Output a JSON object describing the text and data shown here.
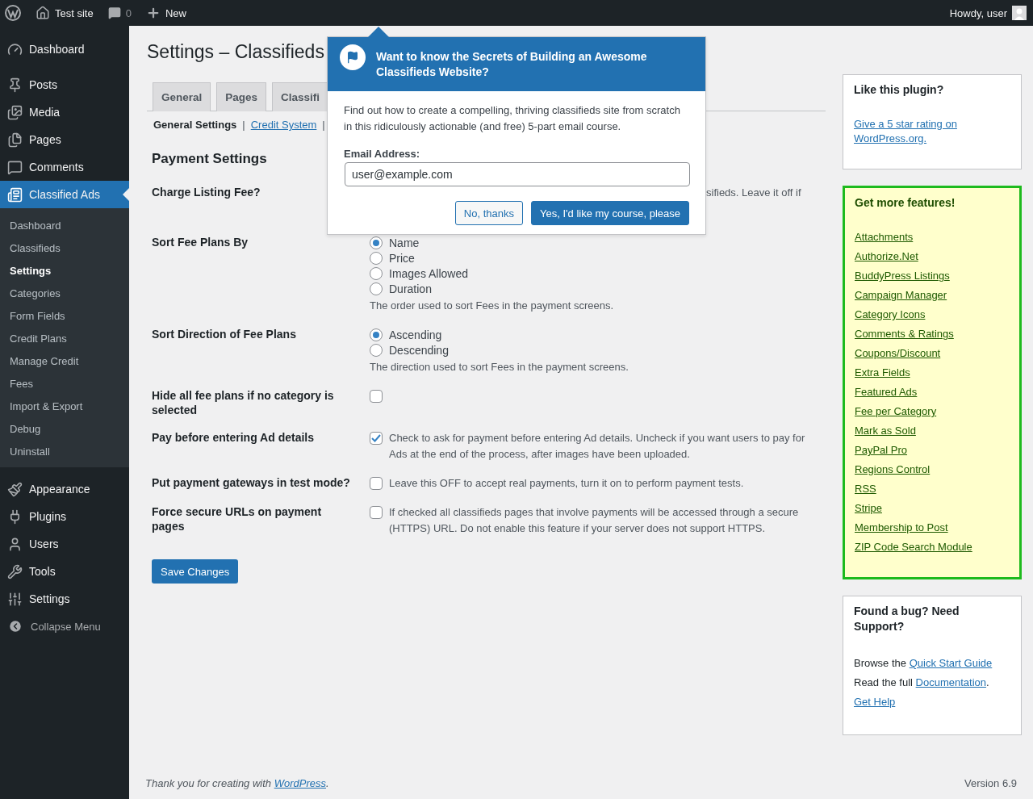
{
  "admin_bar": {
    "site": "Test site",
    "comments": "0",
    "new": "New",
    "greeting": "Howdy, user"
  },
  "sidebar": {
    "items": [
      {
        "label": "Dashboard",
        "selected": false
      },
      {
        "label": "Posts",
        "selected": false
      },
      {
        "label": "Media",
        "selected": false
      },
      {
        "label": "Pages",
        "selected": false
      },
      {
        "label": "Comments",
        "selected": false
      },
      {
        "label": "Classified Ads",
        "selected": true,
        "children": [
          {
            "label": "Dashboard",
            "selected": false
          },
          {
            "label": "Classifieds",
            "selected": false
          },
          {
            "label": "Settings",
            "selected": true
          },
          {
            "label": "Categories",
            "selected": false
          },
          {
            "label": "Form Fields",
            "selected": false
          },
          {
            "label": "Credit Plans",
            "selected": false
          },
          {
            "label": "Manage Credit",
            "selected": false
          },
          {
            "label": "Fees",
            "selected": false
          },
          {
            "label": "Import & Export",
            "selected": false
          },
          {
            "label": "Debug",
            "selected": false
          },
          {
            "label": "Uninstall",
            "selected": false
          }
        ]
      },
      {
        "label": "Appearance",
        "selected": false
      },
      {
        "label": "Plugins",
        "selected": false
      },
      {
        "label": "Users",
        "selected": false
      },
      {
        "label": "Tools",
        "selected": false
      },
      {
        "label": "Settings",
        "selected": false
      }
    ],
    "collapse": "Collapse Menu"
  },
  "page": {
    "title": "Settings – Classifieds",
    "tabs": [
      {
        "label": "General",
        "selected": false
      },
      {
        "label": "Pages",
        "selected": false
      },
      {
        "label": "Classifi",
        "selected": false
      }
    ],
    "subnav": [
      {
        "label": "General Settings",
        "selected": true,
        "separator": "|"
      },
      {
        "label": "Credit System",
        "selected": false,
        "separator": "|"
      }
    ],
    "section_title": "Payment Settings",
    "rows": [
      {
        "kind": "text",
        "label": "Charge Listing Fee?",
        "description": "sifieds. Leave it off if"
      },
      {
        "kind": "radio",
        "label": "Sort Fee Plans By",
        "options": [
          {
            "label": "Name",
            "selected": true
          },
          {
            "label": "Price",
            "selected": false
          },
          {
            "label": "Images Allowed",
            "selected": false
          },
          {
            "label": "Duration",
            "selected": false
          }
        ],
        "description": "The order used to sort Fees in the payment screens."
      },
      {
        "kind": "radio",
        "label": "Sort Direction of Fee Plans",
        "options": [
          {
            "label": "Ascending",
            "selected": true
          },
          {
            "label": "Descending",
            "selected": false
          }
        ],
        "description": "The direction used to sort Fees in the payment screens."
      },
      {
        "kind": "checkbox",
        "label": "Hide all fee plans if no category is selected",
        "checked": false
      },
      {
        "kind": "checkbox",
        "label": "Pay before entering Ad details",
        "checked": true,
        "description": "Check to ask for payment before entering Ad details. Uncheck if you want users to pay for Ads at the end of the process, after images have been uploaded."
      },
      {
        "kind": "checkbox",
        "label": "Put payment gateways in test mode?",
        "checked": false,
        "description": "Leave this OFF to accept real payments, turn it on to perform payment tests."
      },
      {
        "kind": "checkbox",
        "label": "Force secure URLs on payment pages",
        "checked": false,
        "description": "If checked all classifieds pages that involve payments will be accessed through a secure (HTTPS) URL. Do not enable this feature if your server does not support HTTPS."
      }
    ],
    "save_button": "Save Changes"
  },
  "popup": {
    "title": "Want to know the Secrets of Building an Awesome Classifieds Website?",
    "body": "Find out how to create a compelling, thriving classifieds site from scratch in this ridiculously actionable (and free) 5-part email course.",
    "email_label": "Email Address:",
    "email_value": "user@example.com",
    "decline": "No, thanks",
    "accept": "Yes, I'd like my course, please"
  },
  "like_box": {
    "title": "Like this plugin?",
    "link": "Give a 5 star rating on WordPress.org."
  },
  "features_box": {
    "title": "Get more features!",
    "links": [
      "Attachments",
      "Authorize.Net",
      "BuddyPress Listings",
      "Campaign Manager",
      "Category Icons",
      "Comments & Ratings",
      "Coupons/Discount",
      "Extra Fields",
      "Featured Ads",
      "Fee per Category",
      "Mark as Sold",
      "PayPal Pro",
      "Regions Control",
      "RSS",
      "Stripe",
      "Membership to Post",
      "ZIP Code Search Module"
    ]
  },
  "support_box": {
    "title": "Found a bug? Need Support?",
    "lines": [
      {
        "prefix": "Browse the ",
        "link": "Quick Start Guide"
      },
      {
        "prefix": "Read the full ",
        "link": "Documentation",
        "suffix": "."
      },
      {
        "link": "Get Help"
      }
    ]
  },
  "footer": {
    "prefix": "Thank you for creating with ",
    "link": "WordPress",
    "suffix": ".",
    "version": "Version 6.9"
  }
}
